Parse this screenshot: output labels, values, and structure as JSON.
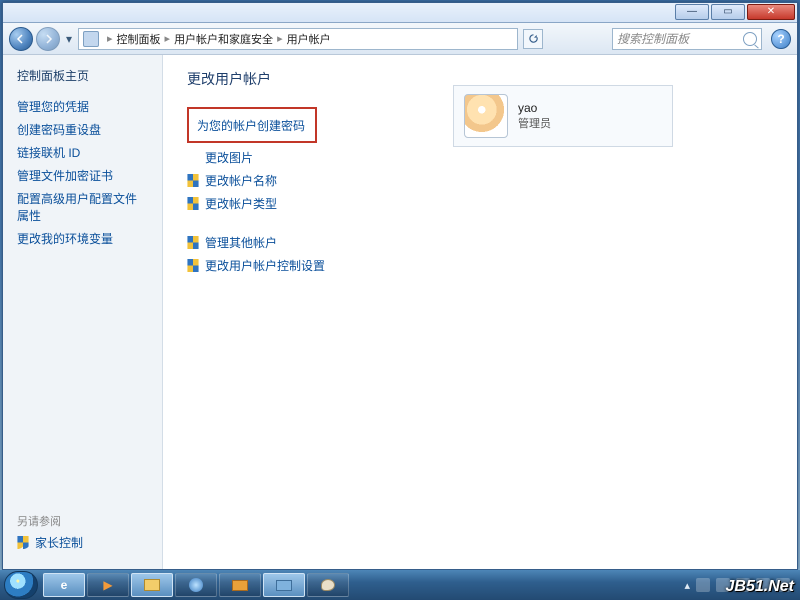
{
  "breadcrumb": {
    "root_icon": "control-panel",
    "items": [
      "控制面板",
      "用户帐户和家庭安全",
      "用户帐户"
    ]
  },
  "search": {
    "placeholder": "搜索控制面板"
  },
  "sidebar": {
    "home": "控制面板主页",
    "links": [
      "管理您的凭据",
      "创建密码重设盘",
      "链接联机 ID",
      "管理文件加密证书",
      "配置高级用户配置文件属性",
      "更改我的环境变量"
    ],
    "see_also_label": "另请参阅",
    "see_also_link": "家长控制"
  },
  "main": {
    "heading": "更改用户帐户",
    "primary_action": "为您的帐户创建密码",
    "actions_group1": [
      "更改图片",
      "更改帐户名称",
      "更改帐户类型"
    ],
    "actions_group2": [
      "管理其他帐户",
      "更改用户帐户控制设置"
    ]
  },
  "user": {
    "name": "yao",
    "role": "管理员"
  },
  "window_buttons": {
    "min": "—",
    "max": "▭",
    "close": "✕"
  },
  "help_button": "?",
  "watermark": "JB51.Net",
  "taskbar": {
    "items": [
      "ie",
      "wmp",
      "explorer",
      "browser",
      "camera",
      "switcher",
      "paint"
    ]
  }
}
